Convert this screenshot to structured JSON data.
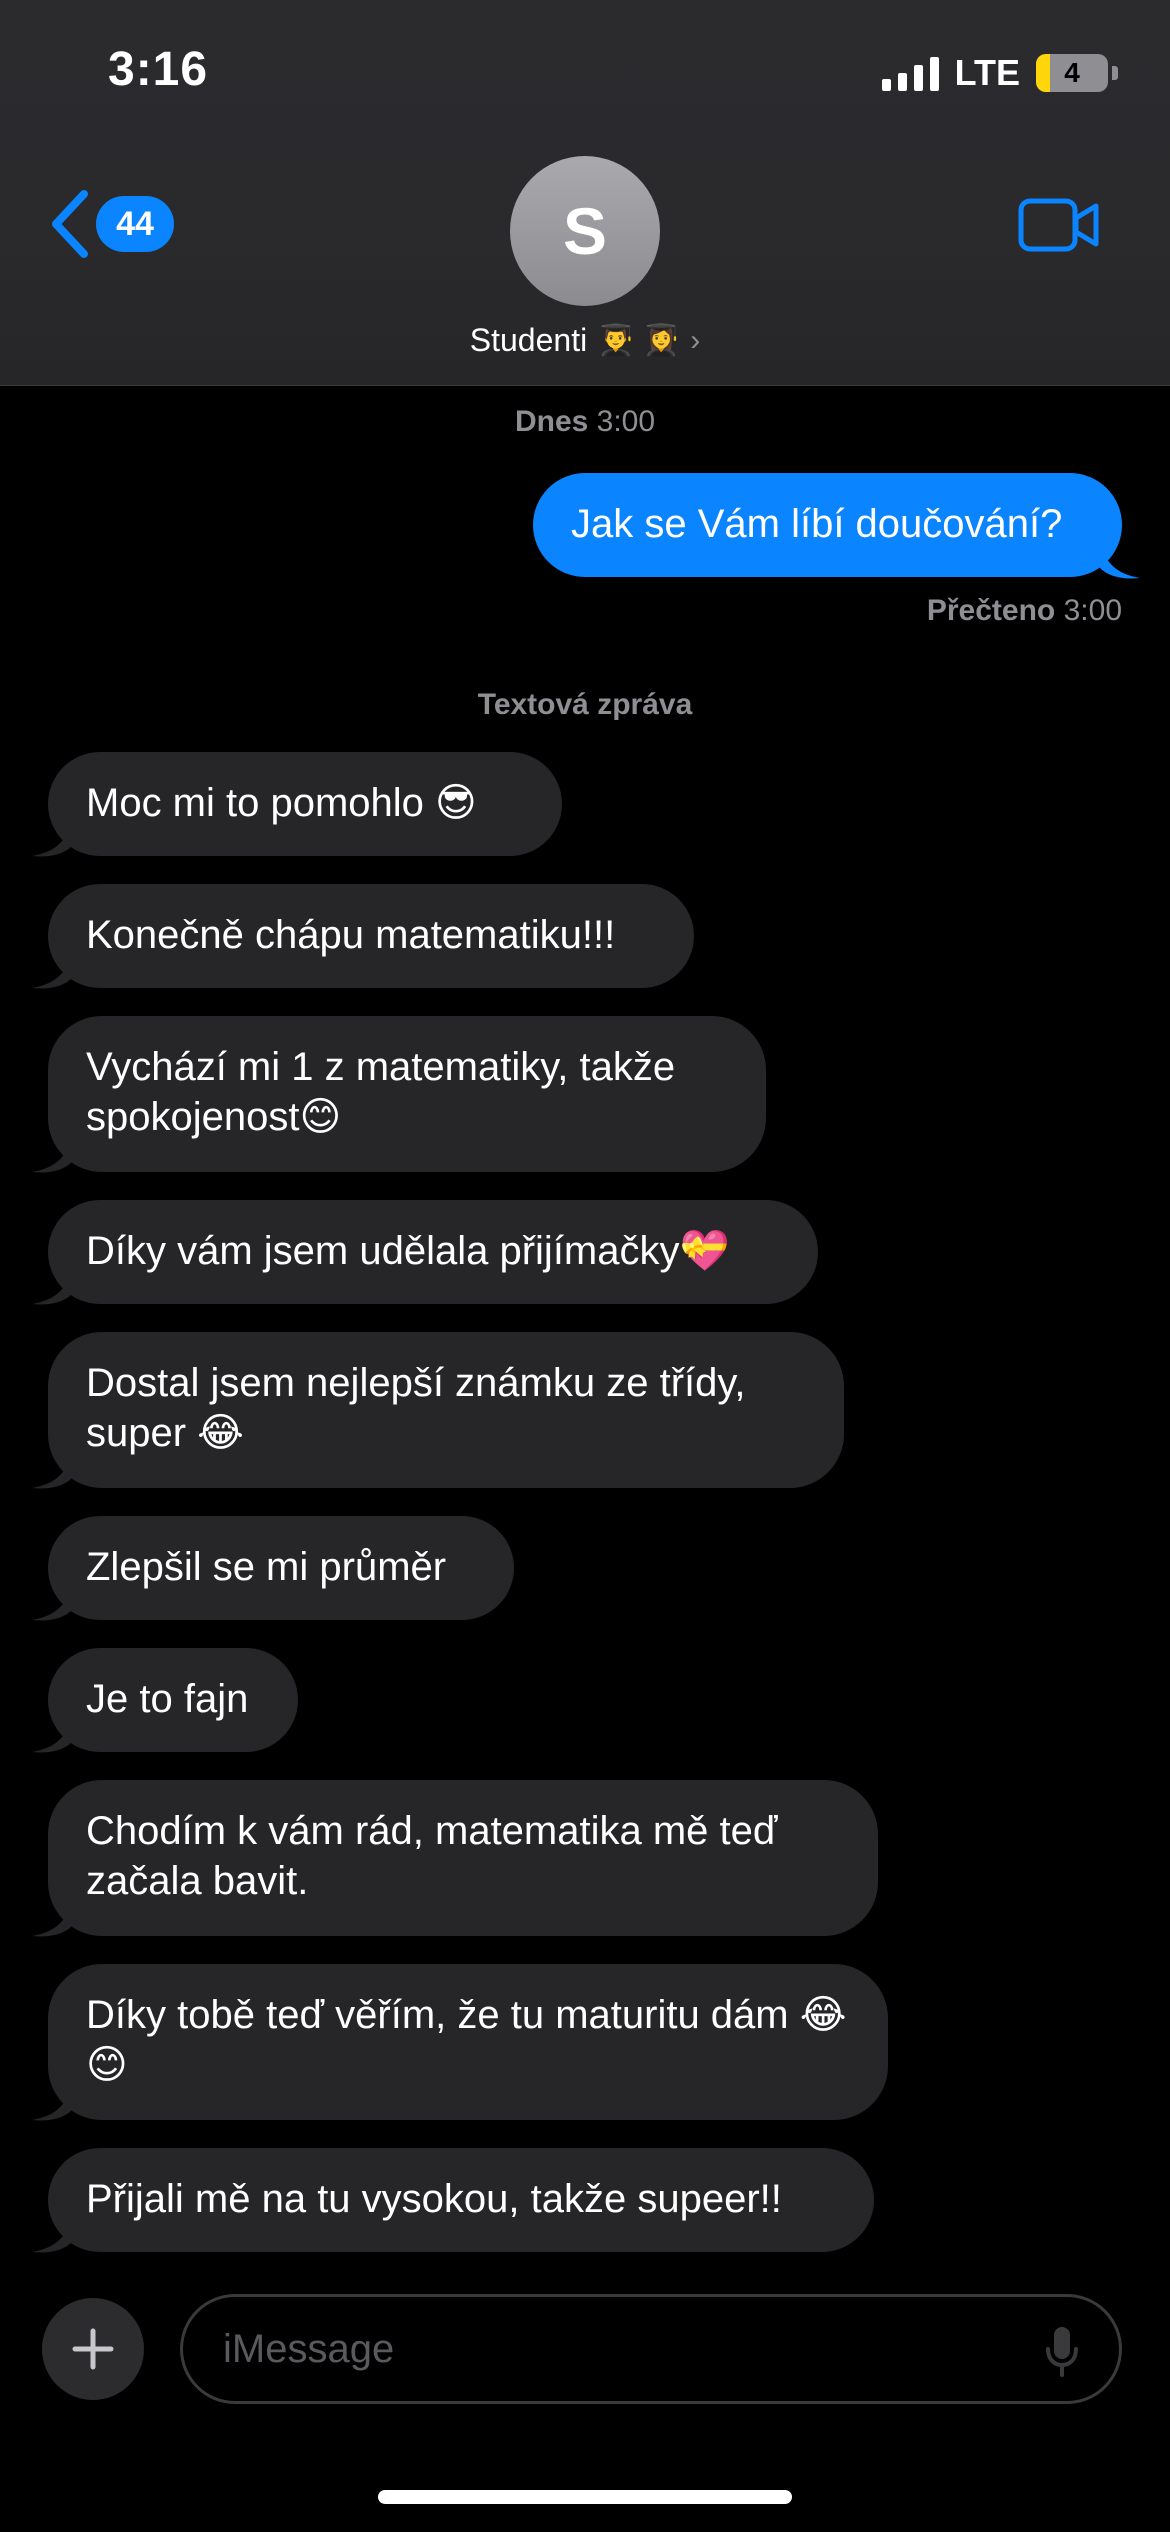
{
  "status_bar": {
    "time": "3:16",
    "network": "LTE",
    "battery": "4"
  },
  "header": {
    "back_count": "44",
    "avatar_initial": "S",
    "contact_name": "Studenti",
    "contact_emoji": "👨‍🎓 👩‍🎓",
    "chevron": "›"
  },
  "thread": {
    "date_day": "Dnes",
    "date_time": "3:00",
    "outgoing": "Jak se Vám líbí doučování?",
    "read_label": "Přečteno",
    "read_time": "3:00",
    "sms_label": "Textová zpráva",
    "incoming": [
      "Moc mi to pomohlo 😎",
      "Konečně chápu matematiku!!!",
      "Vychází mi 1 z matematiky, takže spokojenost😊",
      "Díky vám jsem udělala přijímačky💝",
      "Dostal jsem nejlepší známku ze třídy, super 😂",
      "Zlepšil se mi průměr",
      "Je to fajn",
      "Chodím k vám rád, matematika mě teď začala bavit.",
      "Díky tobě teď věřím, že tu maturitu dám 😂😊",
      "Přijali mě na tu vysokou, takže supeer!!"
    ]
  },
  "input": {
    "placeholder": "iMessage"
  },
  "colors": {
    "accent": "#0a84ff",
    "incoming_bubble": "#262628",
    "secondary_text": "#8e8e93"
  },
  "icons": [
    "back-chevron-icon",
    "video-camera-icon",
    "plus-icon",
    "microphone-icon"
  ]
}
